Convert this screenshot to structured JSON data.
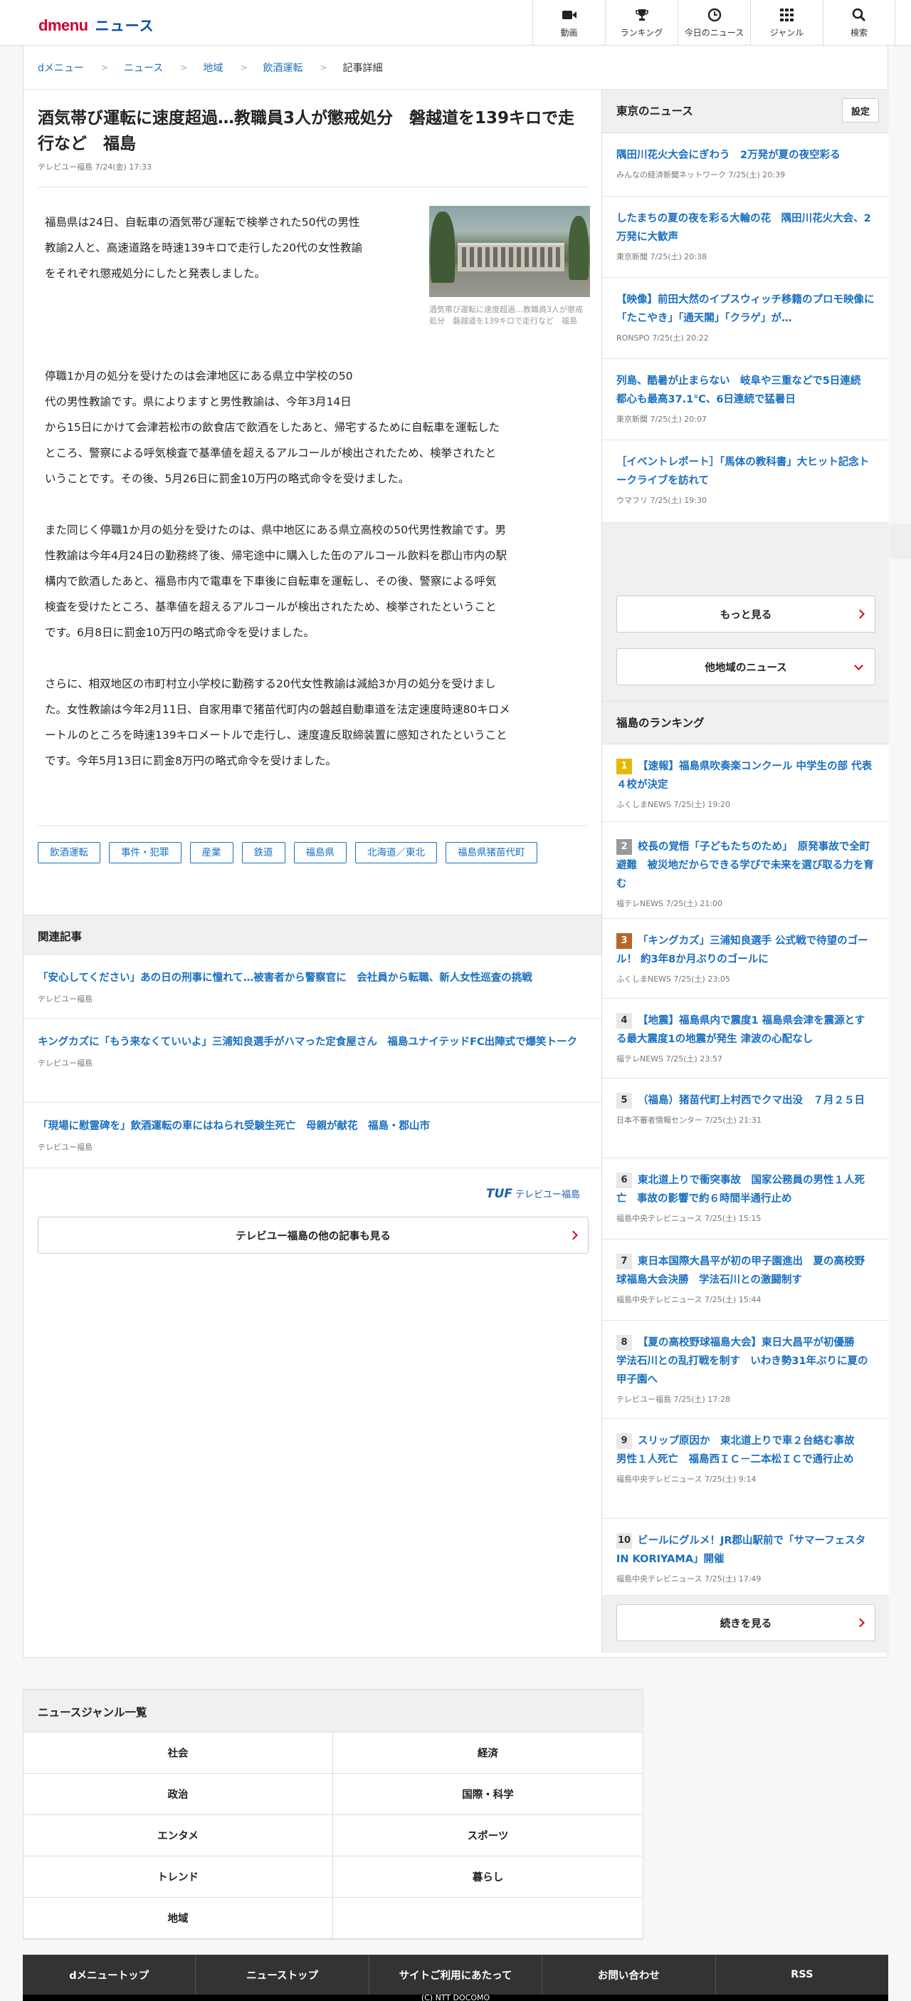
{
  "header": {
    "logo_d": "dmenu",
    "logo_news": "ニュース",
    "nav": [
      {
        "label": "動画",
        "icon": "video-camera-icon"
      },
      {
        "label": "ランキング",
        "icon": "trophy-icon"
      },
      {
        "label": "今日のニュース",
        "icon": "clock-icon"
      },
      {
        "label": "ジャンル",
        "icon": "grid-icon"
      },
      {
        "label": "検索",
        "icon": "search-icon"
      }
    ]
  },
  "breadcrumb": [
    "dメニュー",
    "ニュース",
    "地域",
    "飲酒運転",
    "記事詳細"
  ],
  "article": {
    "title": "酒気帯び運転に速度超過…教職員3人が懲戒処分　磐越道を139キロで走行など　福島",
    "source": "テレビユー福島",
    "date": "7/24(金) 17:33",
    "image_caption": "酒気帯び運転に速度超過…教職員3人が懲戒処分　磐越道を139キロで走行など　福島",
    "p1": [
      "福島県は24日、自転車の酒気帯び運転で検挙された50代の男性",
      "教諭2人と、高速道路を時速139キロで走行した20代の女性教諭",
      "をそれぞれ懲戒処分にしたと発表しました。"
    ],
    "p2": [
      "停職1か月の処分を受けたのは会津地区にある県立中学校の50",
      "代の男性教諭です。県によりますと男性教諭は、今年3月14日",
      "から15日にかけて会津若松市の飲食店で飲酒をしたあと、帰宅するために自転車を運転した",
      "ところ、警察による呼気検査で基準値を超えるアルコールが検出されたため、検挙されたと",
      "いうことです。その後、5月26日に罰金10万円の略式命令を受けました。"
    ],
    "p3": [
      "また同じく停職1か月の処分を受けたのは、県中地区にある県立高校の50代男性教諭です。男",
      "性教諭は今年4月24日の勤務終了後、帰宅途中に購入した缶のアルコール飲料を郡山市内の駅",
      "構内で飲酒したあと、福島市内で電車を下車後に自転車を運転し、その後、警察による呼気",
      "検査を受けたところ、基準値を超えるアルコールが検出されたため、検挙されたということ",
      "です。6月8日に罰金10万円の略式命令を受けました。"
    ],
    "p4": [
      "さらに、相双地区の市町村立小学校に勤務する20代女性教諭は減給3か月の処分を受けまし",
      "た。女性教諭は今年2月11日、自家用車で猪苗代町内の磐越自動車道を法定速度時速80キロメ",
      "ートルのところを時速139キロメートルで走行し、速度違反取締装置に感知されたということ",
      "です。今年5月13日に罰金8万円の略式命令を受けました。"
    ],
    "tags": [
      "飲酒運転",
      "事件・犯罪",
      "産業",
      "鉄道",
      "福島県",
      "北海道／東北",
      "福島県猪苗代町"
    ]
  },
  "related": {
    "heading": "関連記事",
    "items": [
      {
        "title": "「安心してください」あの日の刑事に憧れて…被害者から警察官に　会社員から転職、新人女性巡査の挑戦",
        "source": "テレビユー福島"
      },
      {
        "title": "キングカズに「もう来なくていいよ」三浦知良選手がハマった定食屋さん　福島ユナイテッドFC出陣式で爆笑トーク",
        "source": "テレビユー福島"
      },
      {
        "title": "「現場に慰霊碑を」飲酒運転の車にはねられ受験生死亡　母親が献花　福島・郡山市",
        "source": "テレビユー福島"
      }
    ]
  },
  "provider": {
    "logo": "TUF",
    "logo_sub": "テレビユー福島",
    "more_label": "テレビユー福島の他の記事も見る"
  },
  "tokyo": {
    "heading": "東京のニュース",
    "setting": "設定",
    "items": [
      {
        "title": "隅田川花火大会にぎわう　2万発が夏の夜空彩る",
        "source": "みんなの経済新聞ネットワーク",
        "date": "7/25(土) 20:39"
      },
      {
        "title": "したまちの夏の夜を彩る大輪の花　隅田川花火大会、2万発に大歓声",
        "source": "東京新聞",
        "date": "7/25(土) 20:38"
      },
      {
        "title": "【映像】前田大然のイプスウィッチ移籍のプロモ映像に「たこやき」「通天閣」「クラゲ」が…",
        "source": "RONSPO",
        "date": "7/25(土) 20:22"
      },
      {
        "title": "列島、酷暑が止まらない　岐阜や三重などで5日連続　都心も最高37.1℃、6日連続で猛暑日",
        "source": "東京新聞",
        "date": "7/25(土) 20:07"
      },
      {
        "title": "［イベントレポート］「馬体の教科書」大ヒット記念トークライブを訪れて",
        "source": "ウマフリ",
        "date": "7/25(土) 19:30"
      }
    ],
    "more": "もっと見る",
    "other_region": "他地域のニュース"
  },
  "ranking": {
    "heading": "福島のランキング",
    "items": [
      {
        "rank": "1",
        "title": "【速報】福島県吹奏楽コンクール 中学生の部 代表４校が決定",
        "source": "ふくしまNEWS",
        "date": "7/25(土) 19:20"
      },
      {
        "rank": "2",
        "title": "校長の覚悟「子どもたちのため」　原発事故で全町避難　被災地だからできる学びで未来を選び取る力を育む",
        "source": "福テレNEWS",
        "date": "7/25(土) 21:00"
      },
      {
        "rank": "3",
        "title": "「キングカズ」三浦知良選手 公式戦で待望のゴール！ 約3年8か月ぶりのゴールに",
        "source": "ふくしまNEWS",
        "date": "7/25(土) 23:05"
      },
      {
        "rank": "4",
        "title": "【地震】福島県内で震度1 福島県会津を震源とする最大震度1の地震が発生 津波の心配なし",
        "source": "福テレNEWS",
        "date": "7/25(土) 23:57"
      },
      {
        "rank": "5",
        "title": "（福島）猪苗代町上村西でクマ出没　７月２５日",
        "source": "日本不審者情報センター",
        "date": "7/25(土) 21:31"
      },
      {
        "rank": "6",
        "title": "東北道上りで衝突事故　国家公務員の男性１人死亡　事故の影響で約６時間半通行止め",
        "source": "福島中央テレビニュース",
        "date": "7/25(土) 15:15"
      },
      {
        "rank": "7",
        "title": "東日本国際大昌平が初の甲子園進出　夏の高校野球福島大会決勝　学法石川との激闘制す",
        "source": "福島中央テレビニュース",
        "date": "7/25(土) 15:44"
      },
      {
        "rank": "8",
        "title": "【夏の高校野球福島大会】東日大昌平が初優勝　学法石川との乱打戦を制す　いわき勢31年ぶりに夏の甲子園へ",
        "source": "テレビユー福島",
        "date": "7/25(土) 17:28"
      },
      {
        "rank": "9",
        "title": "スリップ原因か　東北道上りで車２台絡む事故　男性１人死亡　福島西ＩＣ－二本松ＩＣで通行止め",
        "source": "福島中央テレビニュース",
        "date": "7/25(土) 9:14"
      },
      {
        "rank": "10",
        "title": "ビールにグルメ！JR郡山駅前で「サマーフェスタ IN KORIYAMA」開催",
        "source": "福島中央テレビニュース",
        "date": "7/25(土) 17:49"
      }
    ],
    "more": "続きを見る"
  },
  "genre": {
    "heading": "ニュースジャンル一覧",
    "items": [
      "社会",
      "経済",
      "政治",
      "国際・科学",
      "エンタメ",
      "スポーツ",
      "トレンド",
      "暮らし",
      "地域",
      ""
    ]
  },
  "footer": {
    "links": [
      "dメニュートップ",
      "ニューストップ",
      "サイトご利用にあたって",
      "お問い合わせ",
      "RSS"
    ],
    "copyright": "(C) NTT DOCOMO"
  },
  "colors": {
    "brand_red": "#cc0033",
    "link_blue": "#1a6fbf",
    "chevron_red": "#d0021b"
  }
}
